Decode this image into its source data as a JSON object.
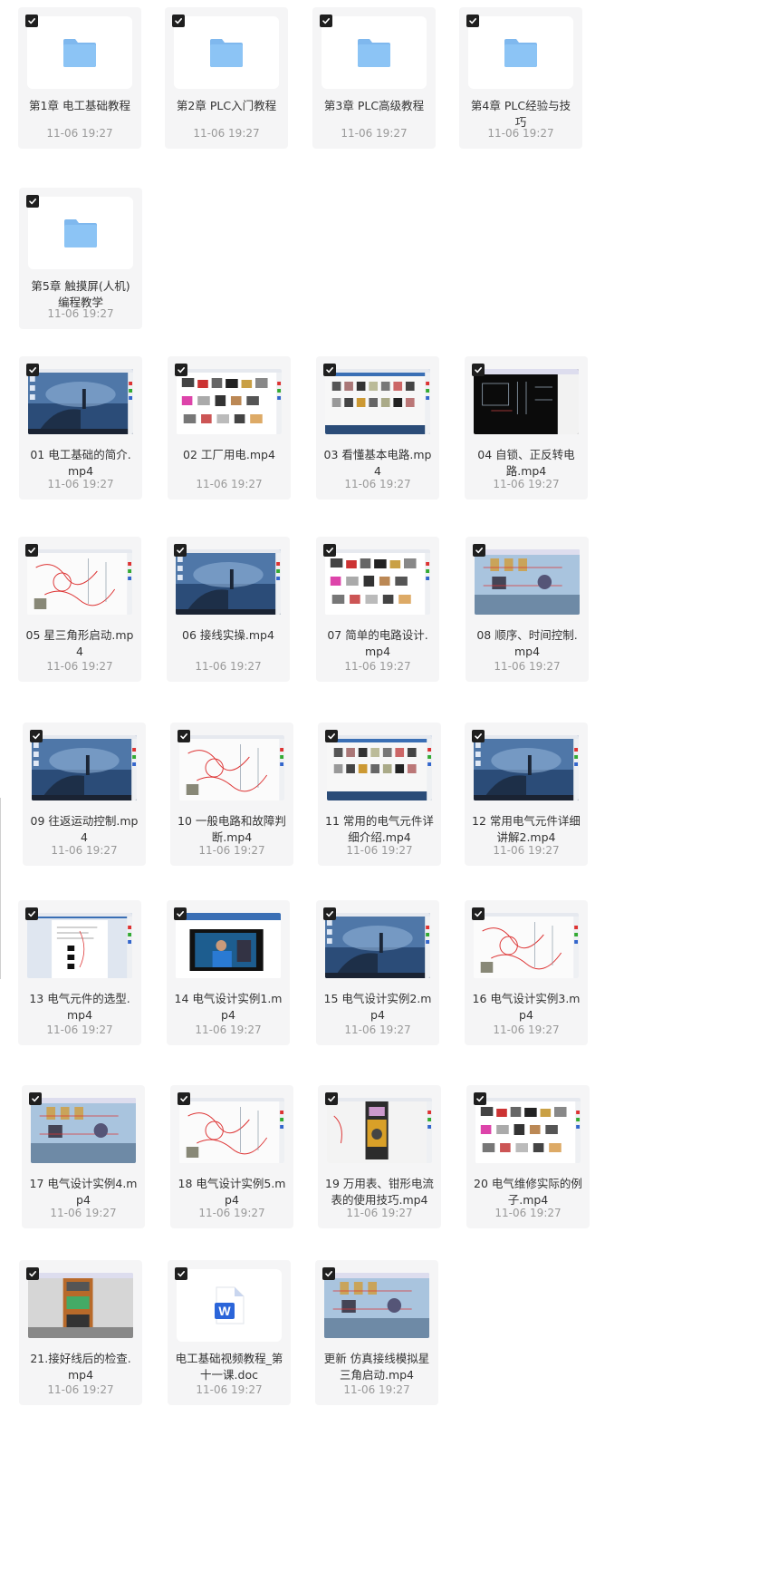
{
  "colors": {
    "card_bg": "#f5f5f6",
    "folder_blue": "#8cc4f5",
    "checkbox": "#1f1f1f",
    "title_text": "#333333",
    "date_text": "#999999",
    "word_blue": "#2b65d9"
  },
  "checkbox_icon": "check-icon",
  "items": [
    {
      "name": "第1章 电工基础教程",
      "date": "11-06 19:27",
      "type": "folder",
      "icon": "folder-icon"
    },
    {
      "name": "第2章 PLC入门教程",
      "date": "11-06 19:27",
      "type": "folder",
      "icon": "folder-icon"
    },
    {
      "name": "第3章 PLC高级教程",
      "date": "11-06 19:27",
      "type": "folder",
      "icon": "folder-icon"
    },
    {
      "name": "第4章 PLC经验与技巧",
      "date": "11-06 19:27",
      "type": "folder",
      "icon": "folder-icon"
    },
    {
      "name": "第5章 触摸屏(人机)编程教学",
      "date": "11-06 19:27",
      "type": "folder",
      "icon": "folder-icon"
    },
    {
      "name": "01 电工基础的简介.mp4",
      "date": "11-06 19:27",
      "type": "video",
      "thumb": "seaside-desktop"
    },
    {
      "name": "02 工厂用电.mp4",
      "date": "11-06 19:27",
      "type": "video",
      "thumb": "component-photos"
    },
    {
      "name": "03 看懂基本电路.mp4",
      "date": "11-06 19:27",
      "type": "video",
      "thumb": "browser-gallery"
    },
    {
      "name": "04 自锁、正反转电路.mp4",
      "date": "11-06 19:27",
      "type": "video",
      "thumb": "cad-dark"
    },
    {
      "name": "05 星三角形启动.mp4",
      "date": "11-06 19:27",
      "type": "video",
      "thumb": "sketch-red"
    },
    {
      "name": "06 接线实操.mp4",
      "date": "11-06 19:27",
      "type": "video",
      "thumb": "seaside-desktop"
    },
    {
      "name": "07 简单的电路设计.mp4",
      "date": "11-06 19:27",
      "type": "video",
      "thumb": "component-photos"
    },
    {
      "name": "08 顺序、时间控制.mp4",
      "date": "11-06 19:27",
      "type": "video",
      "thumb": "simulation"
    },
    {
      "name": "09 往返运动控制.mp4",
      "date": "11-06 19:27",
      "type": "video",
      "thumb": "seaside-desktop"
    },
    {
      "name": "10 一般电路和故障判断.mp4",
      "date": "11-06 19:27",
      "type": "video",
      "thumb": "sketch-red"
    },
    {
      "name": "11 常用的电气元件详细介绍.mp4",
      "date": "11-06 19:27",
      "type": "video",
      "thumb": "browser-gallery"
    },
    {
      "name": "12 常用电气元件详细讲解2.mp4",
      "date": "11-06 19:27",
      "type": "video",
      "thumb": "seaside-desktop"
    },
    {
      "name": "13 电气元件的选型.mp4",
      "date": "11-06 19:27",
      "type": "video",
      "thumb": "document-page"
    },
    {
      "name": "14 电气设计实例1.mp4",
      "date": "11-06 19:27",
      "type": "video",
      "thumb": "person-video"
    },
    {
      "name": "15 电气设计实例2.mp4",
      "date": "11-06 19:27",
      "type": "video",
      "thumb": "seaside-desktop"
    },
    {
      "name": "16 电气设计实例3.mp4",
      "date": "11-06 19:27",
      "type": "video",
      "thumb": "sketch-red"
    },
    {
      "name": "17 电气设计实例4.mp4",
      "date": "11-06 19:27",
      "type": "video",
      "thumb": "simulation"
    },
    {
      "name": "18 电气设计实例5.mp4",
      "date": "11-06 19:27",
      "type": "video",
      "thumb": "sketch-red"
    },
    {
      "name": "19 万用表、钳形电流表的使用技巧.mp4",
      "date": "11-06 19:27",
      "type": "video",
      "thumb": "multimeter"
    },
    {
      "name": "20 电气维修实际的例子.mp4",
      "date": "11-06 19:27",
      "type": "video",
      "thumb": "component-photos"
    },
    {
      "name": "21.接好线后的检查.mp4",
      "date": "11-06 19:27",
      "type": "video",
      "thumb": "cabinet"
    },
    {
      "name": "电工基础视频教程_第十一课.doc",
      "date": "11-06 19:27",
      "type": "doc",
      "icon": "word-doc-icon",
      "doc_letter": "W"
    },
    {
      "name": "更新 仿真接线模拟星三角启动.mp4",
      "date": "11-06 19:27",
      "type": "video",
      "thumb": "simulation"
    }
  ]
}
